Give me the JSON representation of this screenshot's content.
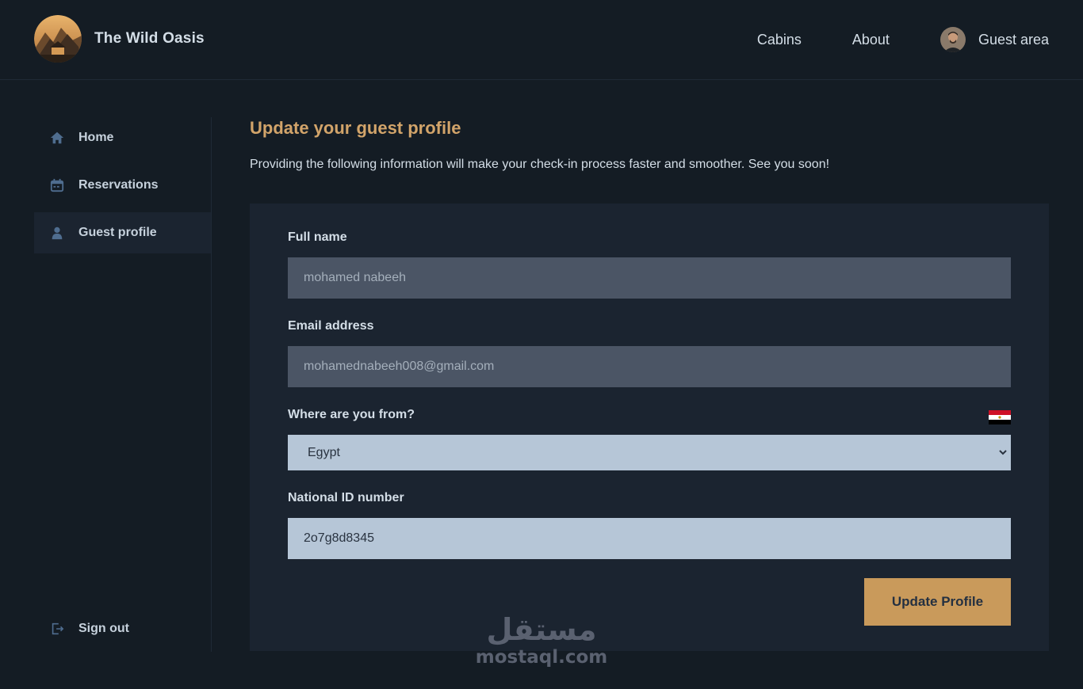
{
  "brand": {
    "name": "The Wild Oasis"
  },
  "nav": {
    "cabins": "Cabins",
    "about": "About",
    "guest_area": "Guest area"
  },
  "sidebar": {
    "items": [
      {
        "label": "Home",
        "icon": "home-icon"
      },
      {
        "label": "Reservations",
        "icon": "calendar-icon"
      },
      {
        "label": "Guest profile",
        "icon": "user-icon",
        "active": true
      }
    ],
    "sign_out": "Sign out"
  },
  "page": {
    "title": "Update your guest profile",
    "subtitle": "Providing the following information will make your check-in process faster and smoother. See you soon!"
  },
  "form": {
    "full_name_label": "Full name",
    "full_name_value": "mohamed nabeeh",
    "email_label": "Email address",
    "email_value": "mohamednabeeh008@gmail.com",
    "country_label": "Where are you from?",
    "country_value": "Egypt",
    "national_id_label": "National ID number",
    "national_id_value": "2o7g8d8345",
    "submit_label": "Update Profile"
  },
  "watermark": {
    "arabic": "مستقل",
    "latin": "mostaql.com"
  },
  "colors": {
    "background": "#141c24",
    "card": "#1b2430",
    "accent": "#d2a46a",
    "button": "#c99a5b",
    "input_disabled": "#4b5565",
    "input_active": "#b6c6d7"
  }
}
